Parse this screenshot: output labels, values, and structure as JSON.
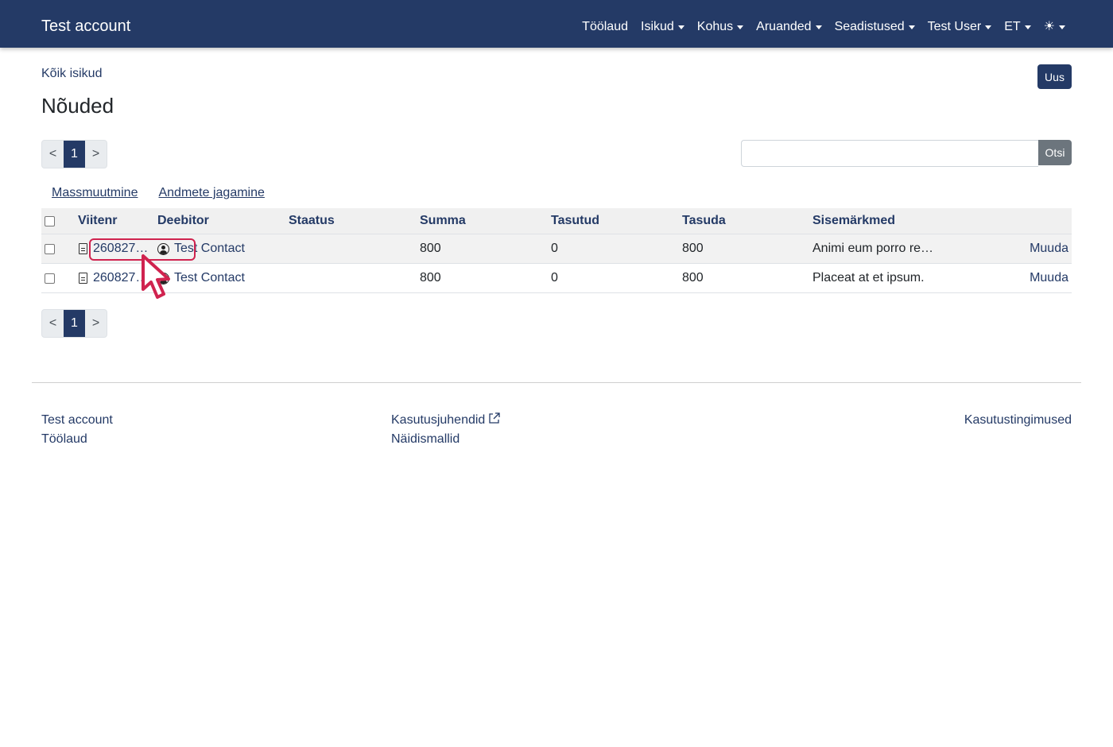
{
  "navbar": {
    "brand": "Test account",
    "items": [
      {
        "label": "Töölaud",
        "dropdown": false
      },
      {
        "label": "Isikud",
        "dropdown": true
      },
      {
        "label": "Kohus",
        "dropdown": true
      },
      {
        "label": "Aruanded",
        "dropdown": true
      },
      {
        "label": "Seadistused",
        "dropdown": true
      },
      {
        "label": "Test User",
        "dropdown": true
      },
      {
        "label": "ET",
        "dropdown": true
      }
    ],
    "theme_icon": "☀"
  },
  "breadcrumb": "Kõik isikud",
  "page_title": "Nõuded",
  "new_button": "Uus",
  "pagination": {
    "prev": "<",
    "current": "1",
    "next": ">"
  },
  "search": {
    "placeholder": "",
    "value": "",
    "button": "Otsi"
  },
  "actions": {
    "mass_edit": "Massmuutmine",
    "share": "Andmete jagamine"
  },
  "table": {
    "headers": {
      "ref": "Viitenr",
      "debtor": "Deebitor",
      "status": "Staatus",
      "sum": "Summa",
      "paid": "Tasutud",
      "due": "Tasuda",
      "notes": "Sisemärkmed"
    },
    "rows": [
      {
        "ref": "260827…",
        "debtor": "Test Contact",
        "status": "",
        "sum": "800",
        "paid": "0",
        "due": "800",
        "notes": "Animi eum porro re…",
        "edit": "Muuda"
      },
      {
        "ref": "260827…",
        "debtor": "Test Contact",
        "status": "",
        "sum": "800",
        "paid": "0",
        "due": "800",
        "notes": "Placeat at et ipsum.",
        "edit": "Muuda"
      }
    ]
  },
  "footer": {
    "col1": [
      "Test account",
      "Töölaud"
    ],
    "col2": [
      "Kasutusjuhendid",
      "Näidismallid"
    ],
    "col3": [
      "Kasutustingimused"
    ]
  },
  "colors": {
    "primary": "#243a66",
    "highlight": "#d0234f",
    "secondary": "#6c757d"
  }
}
